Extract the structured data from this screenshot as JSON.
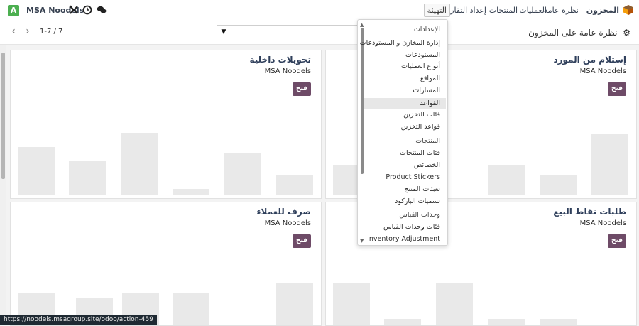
{
  "topbar": {
    "brand": "المخزون",
    "nav": [
      "نظرة عامة",
      "العمليات",
      "المنتجات",
      "إعداد التقارير"
    ],
    "config_label": "التهيئة",
    "company": "MSA Noodels",
    "avatar_letter": "A"
  },
  "control": {
    "pager": "1-7 / 7",
    "page_title": "نظرة عامة على المخزون"
  },
  "cards": [
    {
      "title": "تحويلات داخلية",
      "org": "MSA Noodels",
      "button": "فتح",
      "bars": [
        0.72,
        0.52,
        0.94,
        0.1,
        0.63,
        0.31
      ]
    },
    {
      "title": "إستلام من المورد",
      "org": "MSA Noodels",
      "button": "فتح",
      "bars": [
        0.46,
        0.14,
        0.46,
        0.31,
        0.93
      ]
    },
    {
      "title": "صرف للعملاء",
      "org": "MSA Noodels",
      "button": "فتح",
      "bars": [
        0.7,
        0.58,
        0.7,
        0.7,
        0.9
      ]
    },
    {
      "title": "طلبات نقاط البيع",
      "org": "MSA Noodels",
      "button": "فتح",
      "bars": [
        0.92,
        0.12,
        0.92,
        0.12,
        0.12
      ]
    }
  ],
  "config_menu": {
    "items": [
      {
        "label": "الإعدادات",
        "type": "header"
      },
      {
        "label": "إدارة المخازن و المستودعات",
        "type": "item"
      },
      {
        "label": "المستودعات",
        "type": "item"
      },
      {
        "label": "أنواع العمليات",
        "type": "item"
      },
      {
        "label": "المواقع",
        "type": "item"
      },
      {
        "label": "المسارات",
        "type": "item"
      },
      {
        "label": "القواعد",
        "type": "active"
      },
      {
        "label": "فئات التخزين",
        "type": "item"
      },
      {
        "label": "قواعد التخزين",
        "type": "item"
      },
      {
        "label": "المنتجات",
        "type": "header"
      },
      {
        "label": "فئات المنتجات",
        "type": "item"
      },
      {
        "label": "الخصائص",
        "type": "item"
      },
      {
        "label": "Product Stickers",
        "type": "item"
      },
      {
        "label": "تعبئات المنتج",
        "type": "item"
      },
      {
        "label": "تسميات الباركود",
        "type": "item"
      },
      {
        "label": "وحدات القياس",
        "type": "header"
      },
      {
        "label": "فئات وحدات القياس",
        "type": "item"
      },
      {
        "label": "Inventory Adjustment",
        "type": "item"
      }
    ]
  },
  "status_link": "https://noodels.msagroup.site/odoo/action-459",
  "colors": {
    "button": "#6e4b67",
    "title": "#2f3f5b",
    "avatar": "#4caf50"
  }
}
